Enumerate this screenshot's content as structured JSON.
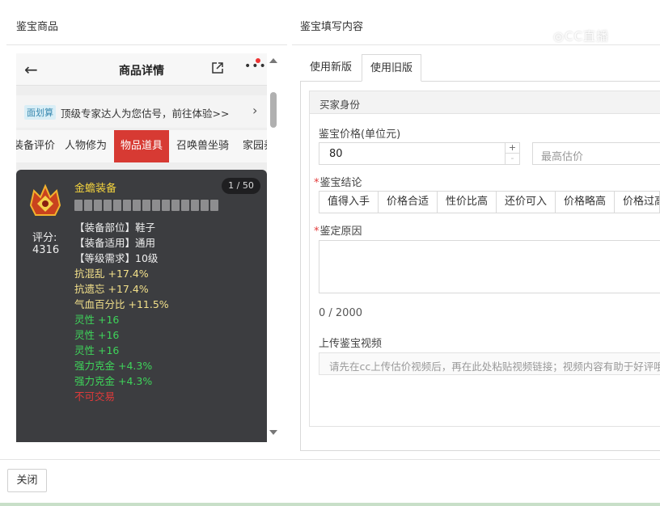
{
  "left_panel": {
    "title": "鉴宝商品"
  },
  "right_panel": {
    "title": "鉴宝填写内容"
  },
  "watermark": "◎CC直播",
  "phone": {
    "header_title": "商品详情",
    "back_icon": "←",
    "more_icon": "•••",
    "promo_tag": "面划算",
    "promo_text": "顶级专家达人为您估号，前往体验>>",
    "promo_arrow": "›",
    "tabs": [
      "装备评价",
      "人物修为",
      "物品道具",
      "召唤兽坐骑",
      "家园养"
    ],
    "active_tab": "物品道具",
    "item": {
      "name": "金蟾装备",
      "counter": "1 / 50",
      "score_label": "评分:",
      "score_value": "4316",
      "attributes": [
        {
          "text": "【装备部位】鞋子",
          "color": "white"
        },
        {
          "text": "【装备适用】通用",
          "color": "white"
        },
        {
          "text": "【等级需求】10级",
          "color": "white"
        },
        {
          "text": "抗混乱 +17.4%",
          "color": "yellow"
        },
        {
          "text": "抗遗忘 +17.4%",
          "color": "yellow"
        },
        {
          "text": "气血百分比 +11.5%",
          "color": "yellow"
        },
        {
          "text": "灵性 +16",
          "color": "green"
        },
        {
          "text": "灵性 +16",
          "color": "green"
        },
        {
          "text": "灵性 +16",
          "color": "green"
        },
        {
          "text": "强力克金 +4.3%",
          "color": "green"
        },
        {
          "text": "强力克金 +4.3%",
          "color": "green"
        },
        {
          "text": "不可交易",
          "color": "red"
        }
      ]
    }
  },
  "form": {
    "tabs": [
      "使用新版",
      "使用旧版"
    ],
    "active_tab": "使用旧版",
    "section_head": "买家身份",
    "price_label": "鉴宝价格(单位元)",
    "price_value": "80",
    "stepper_up": "+",
    "stepper_down": "-",
    "max_placeholder": "最高估价",
    "conclusion_label": "鉴宝结论",
    "conclusion_options": [
      "值得入手",
      "价格合适",
      "性价比高",
      "还价可入",
      "价格略高",
      "价格过高"
    ],
    "reason_label": "鉴定原因",
    "char_counter": "0 / 2000",
    "video_label": "上传鉴宝视频",
    "video_placeholder": "请先在cc上传估价视频后，再在此处粘贴视频链接；视频内容有助于好评哦~",
    "required_mark": "*"
  },
  "footer": {
    "close_label": "关闭"
  },
  "colors": {
    "active_tab_red": "#d73a33",
    "card_bg": "#3c3d40",
    "attr_yellow": "#f2e08a",
    "attr_green": "#3ed45a",
    "attr_red": "#e23a3a"
  },
  "icons": [
    "back-arrow-icon",
    "share-icon",
    "more-dots-icon",
    "equipment-icon",
    "scroll-up-icon",
    "scroll-down-icon"
  ]
}
